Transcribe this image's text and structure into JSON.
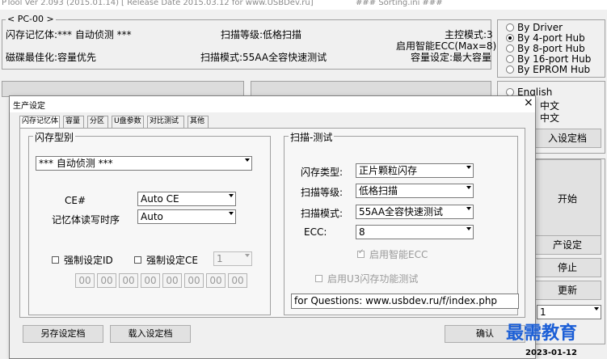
{
  "window": {
    "title_left": "PTool Ver 2.093 (2015.01.14)",
    "title_center": "[ Release Date 2015.03.12 for www.USBDev.ru]",
    "title_right": "### Sorting.ini ###"
  },
  "pc_panel": {
    "legend": "< PC-00 >",
    "flash_memory": "闪存记忆体:*** 自动侦测 ***",
    "scan_level": "扫描等级:低格扫描",
    "master_mode": "主控模式:3",
    "smart_ecc": "启用智能ECC(Max=8)",
    "disk_optimize": "磁碟最佳化:容量优先",
    "scan_mode": "扫描模式:55AA全容快速测试",
    "capacity_setting": "容量设定:最大容量"
  },
  "hub_options": [
    {
      "label": "By Driver",
      "checked": false
    },
    {
      "label": "By 4-port Hub",
      "checked": true
    },
    {
      "label": "By 8-port Hub",
      "checked": false
    },
    {
      "label": "By 16-port Hub",
      "checked": false
    },
    {
      "label": "By EPROM Hub",
      "checked": false
    }
  ],
  "language": {
    "english": "English",
    "chinese_partial_1": "中文",
    "chinese_partial_2": "中文",
    "english_checked": false
  },
  "right_buttons": {
    "load_settings_partial": "入设定档",
    "start_partial": "开始",
    "production_settings_partial": "产设定",
    "stop_partial": "停止",
    "update_partial": "更新",
    "combo_value": "1"
  },
  "dialog": {
    "title": "生产设定",
    "close_label": "×",
    "tabs": [
      "闪存记忆体",
      "容量",
      "分区",
      "U盘参数",
      "对比测试",
      "其他"
    ],
    "flash_group": {
      "legend": "闪存型别",
      "flash_type_value": "*** 自动侦测 ***",
      "ce_label": "CE#",
      "ce_value": "Auto CE",
      "timing_label": "记忆体读写时序",
      "timing_value": "Auto",
      "force_id_label": "强制设定ID",
      "force_ce_label": "强制设定CE",
      "force_ce_value": "1",
      "id_bytes": [
        "00",
        "00",
        "00",
        "00",
        "00",
        "00",
        "00",
        "00"
      ]
    },
    "scan_group": {
      "legend": "扫描-测试",
      "flash_type_label": "闪存类型:",
      "flash_type_value": "正片颗粒闪存",
      "scan_level_label": "扫描等级:",
      "scan_level_value": "低格扫描",
      "scan_mode_label": "扫描模式:",
      "scan_mode_value": "55AA全容快速测试",
      "ecc_label": "ECC:",
      "ecc_value": "8",
      "smart_ecc_label": "启用智能ECC",
      "u3_test_label": "启用U3闪存功能测试",
      "questions_text": "for Questions: www.usbdev.ru/f/index.php"
    },
    "buttons": {
      "save_settings": "另存设定档",
      "load_settings": "载入设定档",
      "confirm": "确认"
    }
  },
  "watermark": {
    "text": "最需教育",
    "date": "2023-01-12"
  }
}
